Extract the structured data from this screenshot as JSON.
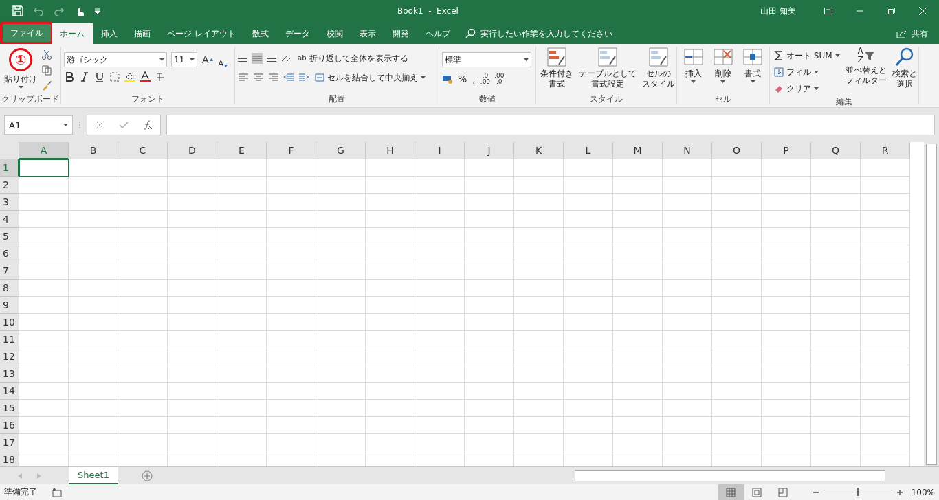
{
  "window": {
    "title": "Book1  -  Excel",
    "user": "山田 知美"
  },
  "tabs": [
    {
      "label": "ファイル",
      "selected": false,
      "outlined": true
    },
    {
      "label": "ホーム",
      "selected": true,
      "outlined": false
    },
    {
      "label": "挿入",
      "selected": false,
      "outlined": false
    },
    {
      "label": "描画",
      "selected": false,
      "outlined": false
    },
    {
      "label": "ページ レイアウト",
      "selected": false,
      "outlined": false
    },
    {
      "label": "数式",
      "selected": false,
      "outlined": false
    },
    {
      "label": "データ",
      "selected": false,
      "outlined": false
    },
    {
      "label": "校閲",
      "selected": false,
      "outlined": false
    },
    {
      "label": "表示",
      "selected": false,
      "outlined": false
    },
    {
      "label": "開発",
      "selected": false,
      "outlined": false
    },
    {
      "label": "ヘルプ",
      "selected": false,
      "outlined": false
    }
  ],
  "tell_me": {
    "placeholder": "実行したい作業を入力してください"
  },
  "share": "共有",
  "annotation": {
    "step": "①"
  },
  "ribbon": {
    "clipboard": {
      "paste": "貼り付け",
      "label": "クリップボード"
    },
    "font": {
      "font_name": "游ゴシック",
      "font_size": "11",
      "grow_glyph": "A",
      "shrink_glyph": "A",
      "label": "フォント"
    },
    "alignment": {
      "wrap_glyph": "ab",
      "wrap": "折り返して全体を表示する",
      "merge": "セルを結合して中央揃え",
      "label": "配置"
    },
    "number": {
      "format": "標準",
      "percent": "%",
      "comma": ",",
      "increase_decimal": [
        ".0",
        ".00"
      ],
      "decrease_decimal": [
        ".00",
        ".0"
      ],
      "label": "数値"
    },
    "styles": {
      "buttons": [
        {
          "lines": [
            "条件付き",
            "書式"
          ]
        },
        {
          "lines": [
            "テーブルとして",
            "書式設定"
          ]
        },
        {
          "lines": [
            "セルの",
            "スタイル"
          ]
        }
      ],
      "label": "スタイル"
    },
    "cells": {
      "buttons": [
        "挿入",
        "削除",
        "書式"
      ],
      "label": "セル"
    },
    "editing": {
      "autosum": "オート SUM",
      "fill": "フィル",
      "clear": "クリア",
      "sort_glyphs": [
        "A",
        "Z"
      ],
      "sort": [
        "並べ替えと",
        "フィルター"
      ],
      "find": [
        "検索と",
        "選択"
      ],
      "label": "編集"
    }
  },
  "formula_bar": {
    "name_box": "A1"
  },
  "grid": {
    "columns": [
      {
        "label": "A",
        "selected": true
      },
      {
        "label": "B",
        "selected": false
      },
      {
        "label": "C",
        "selected": false
      },
      {
        "label": "D",
        "selected": false
      },
      {
        "label": "E",
        "selected": false
      },
      {
        "label": "F",
        "selected": false
      },
      {
        "label": "G",
        "selected": false
      },
      {
        "label": "H",
        "selected": false
      },
      {
        "label": "I",
        "selected": false
      },
      {
        "label": "J",
        "selected": false
      },
      {
        "label": "K",
        "selected": false
      },
      {
        "label": "L",
        "selected": false
      },
      {
        "label": "M",
        "selected": false
      },
      {
        "label": "N",
        "selected": false
      },
      {
        "label": "O",
        "selected": false
      },
      {
        "label": "P",
        "selected": false
      },
      {
        "label": "Q",
        "selected": false
      },
      {
        "label": "R",
        "selected": false
      }
    ],
    "rows": [
      {
        "label": "1",
        "selected": true
      },
      {
        "label": "2",
        "selected": false
      },
      {
        "label": "3",
        "selected": false
      },
      {
        "label": "4",
        "selected": false
      },
      {
        "label": "5",
        "selected": false
      },
      {
        "label": "6",
        "selected": false
      },
      {
        "label": "7",
        "selected": false
      },
      {
        "label": "8",
        "selected": false
      },
      {
        "label": "9",
        "selected": false
      },
      {
        "label": "10",
        "selected": false
      },
      {
        "label": "11",
        "selected": false
      },
      {
        "label": "12",
        "selected": false
      },
      {
        "label": "13",
        "selected": false
      },
      {
        "label": "14",
        "selected": false
      },
      {
        "label": "15",
        "selected": false
      },
      {
        "label": "16",
        "selected": false
      },
      {
        "label": "17",
        "selected": false
      },
      {
        "label": "18",
        "selected": false
      }
    ]
  },
  "sheets": [
    {
      "name": "Sheet1",
      "selected": true
    }
  ],
  "status_bar": {
    "status": "準備完了",
    "views": [
      {
        "kind": "normal",
        "selected": true
      },
      {
        "kind": "page-layout",
        "selected": false
      },
      {
        "kind": "page-break",
        "selected": false
      }
    ],
    "zoom": {
      "level": 0.5,
      "reading": "100%"
    }
  }
}
